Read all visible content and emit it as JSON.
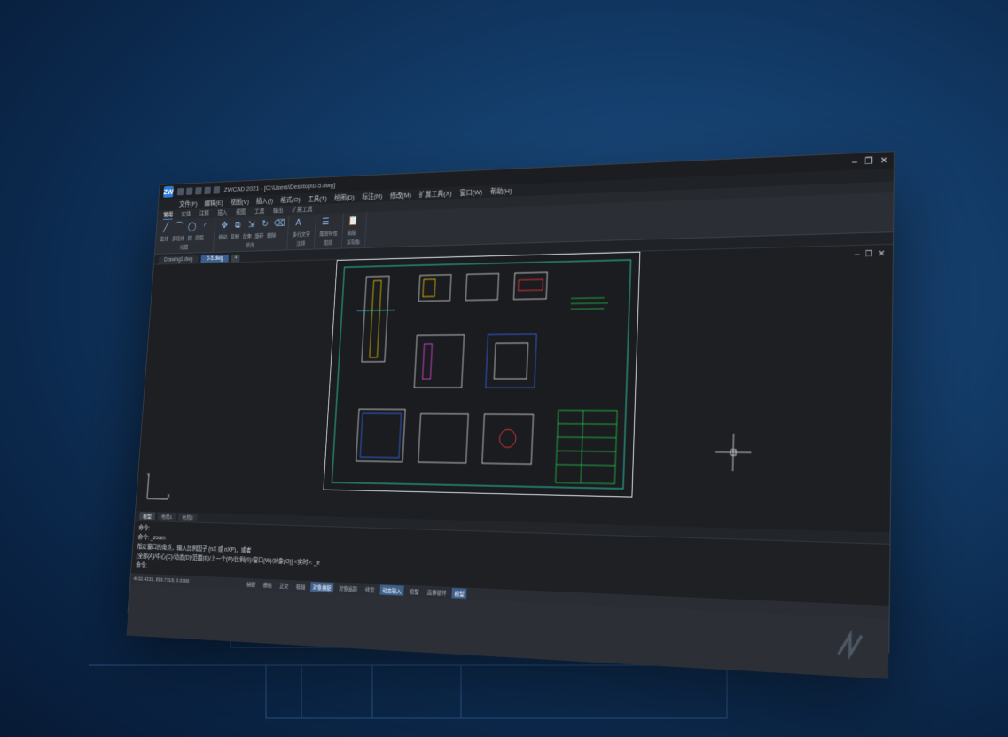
{
  "app": {
    "title": "ZWCAD 2021 - [C:\\Users\\Desktop\\0-5.dwg]",
    "logo": "ZW"
  },
  "window_controls": [
    "–",
    "❐",
    "✕"
  ],
  "menu": [
    "文件(F)",
    "编辑(E)",
    "视图(V)",
    "插入(I)",
    "格式(O)",
    "工具(T)",
    "绘图(D)",
    "标注(N)",
    "修改(M)",
    "扩展工具(X)",
    "窗口(W)",
    "帮助(H)"
  ],
  "ribbon_tabs": [
    "常用",
    "实体",
    "注释",
    "插入",
    "视图",
    "工具",
    "输出",
    "扩展工具"
  ],
  "ribbon_groups": [
    {
      "label": "绘图",
      "tools": [
        "直线",
        "多段线",
        "圆",
        "圆弧"
      ]
    },
    {
      "label": "修改",
      "tools": [
        "移动",
        "复制",
        "拉伸",
        "旋转",
        "删除"
      ]
    },
    {
      "label": "注释",
      "tools": [
        "多行文字"
      ]
    },
    {
      "label": "图层",
      "tools": [
        "图层特性"
      ]
    },
    {
      "label": "剪贴板",
      "tools": [
        "粘贴"
      ]
    }
  ],
  "doc_tabs": [
    "Drawing1.dwg",
    "0-5.dwg"
  ],
  "doc_tab_add": "+",
  "layout_tabs": [
    "模型",
    "布局1",
    "布局2"
  ],
  "command_lines": [
    "命令:",
    "命令: _zoom",
    "指定窗口的角点，输入比例因子 (nX 或 nXP)，或者",
    "[全部(A)/中心(C)/动态(D)/范围(E)/上一个(P)/比例(S)/窗口(W)/对象(O)] <实时>: _e",
    "命令:"
  ],
  "status": {
    "coords": "4632.4315, 819.7318, 0.0000",
    "buttons": [
      {
        "label": "捕捉",
        "on": false
      },
      {
        "label": "栅格",
        "on": false
      },
      {
        "label": "正交",
        "on": false
      },
      {
        "label": "极轴",
        "on": false
      },
      {
        "label": "对象捕捉",
        "on": true
      },
      {
        "label": "对象追踪",
        "on": false
      },
      {
        "label": "线宽",
        "on": false
      },
      {
        "label": "动态输入",
        "on": true
      },
      {
        "label": "模型",
        "on": false
      },
      {
        "label": "选择循环",
        "on": false
      },
      {
        "label": "模型",
        "on": true
      }
    ]
  },
  "canvas_controls": [
    "–",
    "❐",
    "✕"
  ],
  "ucs": {
    "x": "X",
    "y": "Y"
  }
}
